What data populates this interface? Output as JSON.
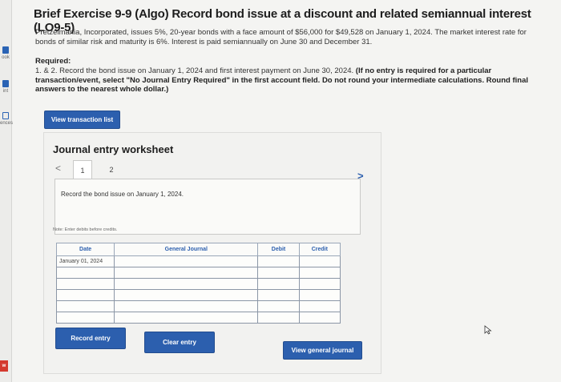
{
  "rail": {
    "items": [
      {
        "label": "ook"
      },
      {
        "label": "int"
      },
      {
        "label": "ences"
      }
    ],
    "badge": "w"
  },
  "title": "Brief Exercise 9-9 (Algo) Record bond issue at a discount and related semiannual interest (LO9-5)",
  "problem_text": "Pretzelmania, Incorporated, issues 5%, 20-year bonds with a face amount of $56,000 for $49,528 on January 1, 2024. The market interest rate for bonds of similar risk and maturity is 6%. Interest is paid semiannually on June 30 and December 31.",
  "required": {
    "heading": "Required:",
    "prefix": "1. & 2. Record the bond issue on January 1, 2024 and first interest payment on June 30, 2024.",
    "bold": "(If no entry is required for a particular transaction/event, select \"No Journal Entry Required\" in the first account field. Do not round your intermediate calculations. Round final answers to the nearest whole dollar.)"
  },
  "buttons": {
    "view_transaction_list": "View transaction list",
    "record_entry": "Record entry",
    "clear_entry": "Clear entry",
    "view_general_journal": "View general journal"
  },
  "worksheet": {
    "title": "Journal entry worksheet",
    "prev": "<",
    "next": ">",
    "tabs": [
      "1",
      "2"
    ],
    "description": "Record the bond issue on January 1, 2024.",
    "note": "Note: Enter debits before credits.",
    "columns": {
      "date": "Date",
      "general_journal": "General Journal",
      "debit": "Debit",
      "credit": "Credit"
    },
    "rows": [
      {
        "date": "January 01, 2024",
        "account": "",
        "debit": "",
        "credit": ""
      },
      {
        "date": "",
        "account": "",
        "debit": "",
        "credit": ""
      },
      {
        "date": "",
        "account": "",
        "debit": "",
        "credit": ""
      },
      {
        "date": "",
        "account": "",
        "debit": "",
        "credit": ""
      },
      {
        "date": "",
        "account": "",
        "debit": "",
        "credit": ""
      },
      {
        "date": "",
        "account": "",
        "debit": "",
        "credit": ""
      }
    ]
  },
  "colors": {
    "accent": "#2c5fae",
    "badge": "#d43a2f"
  }
}
